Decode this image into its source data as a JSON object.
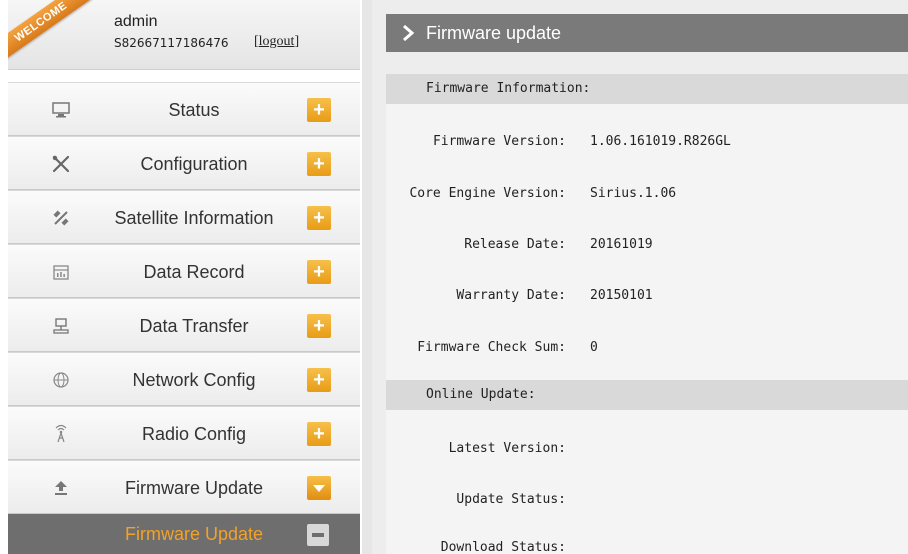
{
  "user": {
    "welcome_ribbon": "WELCOME",
    "username": "admin",
    "serial": "S82667117186476",
    "logout_label": "logout"
  },
  "sidebar": {
    "items": [
      {
        "label": "Status",
        "icon": "monitor-icon",
        "state": "+"
      },
      {
        "label": "Configuration",
        "icon": "tools-icon",
        "state": "+"
      },
      {
        "label": "Satellite Information",
        "icon": "satellite-icon",
        "state": "+"
      },
      {
        "label": "Data Record",
        "icon": "calendar-icon",
        "state": "+"
      },
      {
        "label": "Data Transfer",
        "icon": "network-transfer-icon",
        "state": "+"
      },
      {
        "label": "Network Config",
        "icon": "globe-icon",
        "state": "+"
      },
      {
        "label": "Radio Config",
        "icon": "antenna-icon",
        "state": "+"
      },
      {
        "label": "Firmware Update",
        "icon": "upload-icon",
        "state": "expanded"
      }
    ],
    "sub_item": {
      "label": "Firmware Update",
      "state": "-"
    }
  },
  "header": {
    "title": "Firmware update"
  },
  "firmware_info": {
    "section_title": "Firmware Information:",
    "rows": [
      {
        "key": "Firmware Version:",
        "value": "1.06.161019.R826GL"
      },
      {
        "key": "Core Engine Version:",
        "value": "Sirius.1.06"
      },
      {
        "key": "Release Date:",
        "value": "20161019"
      },
      {
        "key": "Warranty Date:",
        "value": "20150101"
      },
      {
        "key": "Firmware Check Sum:",
        "value": "0"
      }
    ]
  },
  "online_update": {
    "section_title": "Online Update:",
    "rows": [
      {
        "key": "Latest Version:",
        "value": ""
      },
      {
        "key": "Update Status:",
        "value": ""
      },
      {
        "key": "Download Status:",
        "value": ""
      }
    ]
  },
  "colors": {
    "accent_orange": "#f2a22a",
    "header_grey": "#7a7a7a",
    "selected_dark": "#6e6e6e"
  }
}
